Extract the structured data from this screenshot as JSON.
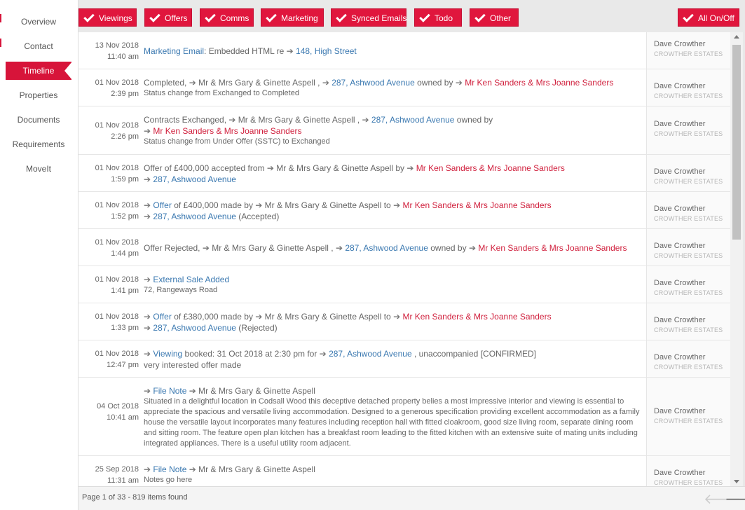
{
  "sidebar": {
    "items": [
      {
        "label": "Overview",
        "active": false
      },
      {
        "label": "Contact",
        "active": false
      },
      {
        "label": "Timeline",
        "active": true
      },
      {
        "label": "Properties",
        "active": false
      },
      {
        "label": "Documents",
        "active": false
      },
      {
        "label": "Requirements",
        "active": false
      },
      {
        "label": "MoveIt",
        "active": false
      }
    ]
  },
  "filters": {
    "buttons": [
      "Viewings",
      "Offers",
      "Comms",
      "Marketing",
      "Synced Emails",
      "Todo",
      "Other"
    ],
    "all_toggle": "All On/Off"
  },
  "colors": {
    "accent": "#d7143a",
    "link": "#3a78b0",
    "party": "#d01f3c"
  },
  "timeline": {
    "rows": [
      {
        "date": "13 Nov 2018",
        "time": "11:40 am",
        "parts": [
          [
            "l",
            "Marketing Email"
          ],
          [
            "t",
            ": Embedded HTML re "
          ],
          [
            "a",
            ""
          ],
          [
            "l",
            " 148, High Street"
          ]
        ],
        "sub": "",
        "agent": "Dave Crowther",
        "company": "CROWTHER ESTATES"
      },
      {
        "date": "01 Nov 2018",
        "time": "2:39 pm",
        "parts": [
          [
            "t",
            "Completed, "
          ],
          [
            "a",
            ""
          ],
          [
            "t",
            " Mr & Mrs Gary & Ginette Aspell , "
          ],
          [
            "a",
            ""
          ],
          [
            "l",
            " 287, Ashwood Avenue"
          ],
          [
            "t",
            " owned by "
          ],
          [
            "a",
            ""
          ],
          [
            "r",
            " Mr Ken Sanders & Mrs Joanne Sanders"
          ]
        ],
        "sub": "Status change from Exchanged to Completed",
        "agent": "Dave Crowther",
        "company": "CROWTHER ESTATES"
      },
      {
        "date": "01 Nov 2018",
        "time": "2:26 pm",
        "parts": [
          [
            "t",
            "Contracts Exchanged, "
          ],
          [
            "a",
            ""
          ],
          [
            "t",
            " Mr & Mrs Gary & Ginette Aspell , "
          ],
          [
            "a",
            ""
          ],
          [
            "l",
            " 287, Ashwood Avenue"
          ],
          [
            "t",
            " owned by"
          ],
          [
            "br",
            ""
          ],
          [
            "a",
            ""
          ],
          [
            "r",
            " Mr Ken Sanders & Mrs Joanne Sanders"
          ]
        ],
        "sub": "Status change from Under Offer (SSTC) to Exchanged",
        "agent": "Dave Crowther",
        "company": "CROWTHER ESTATES"
      },
      {
        "date": "01 Nov 2018",
        "time": "1:59 pm",
        "parts": [
          [
            "t",
            "Offer of £400,000 accepted from "
          ],
          [
            "a",
            ""
          ],
          [
            "t",
            " Mr & Mrs Gary & Ginette Aspell by "
          ],
          [
            "a",
            ""
          ],
          [
            "r",
            " Mr Ken Sanders & Mrs Joanne Sanders"
          ],
          [
            "br",
            ""
          ],
          [
            "a",
            ""
          ],
          [
            "l",
            " 287, Ashwood Avenue"
          ]
        ],
        "sub": "",
        "agent": "Dave Crowther",
        "company": "CROWTHER ESTATES"
      },
      {
        "date": "01 Nov 2018",
        "time": "1:52 pm",
        "parts": [
          [
            "a",
            ""
          ],
          [
            "l",
            " Offer"
          ],
          [
            "t",
            " of £400,000 made by "
          ],
          [
            "a",
            ""
          ],
          [
            "t",
            " Mr & Mrs Gary & Ginette Aspell to "
          ],
          [
            "a",
            ""
          ],
          [
            "r",
            " Mr Ken Sanders & Mrs Joanne Sanders"
          ],
          [
            "br",
            ""
          ],
          [
            "a",
            ""
          ],
          [
            "l",
            " 287, Ashwood Avenue"
          ],
          [
            "t",
            " (Accepted)"
          ]
        ],
        "sub": "",
        "agent": "Dave Crowther",
        "company": "CROWTHER ESTATES"
      },
      {
        "date": "01 Nov 2018",
        "time": "1:44 pm",
        "parts": [
          [
            "t",
            "Offer Rejected, "
          ],
          [
            "a",
            ""
          ],
          [
            "t",
            " Mr & Mrs Gary & Ginette Aspell , "
          ],
          [
            "a",
            ""
          ],
          [
            "l",
            " 287, Ashwood Avenue"
          ],
          [
            "t",
            " owned by "
          ],
          [
            "a",
            ""
          ],
          [
            "r",
            " Mr Ken Sanders & Mrs Joanne Sanders"
          ]
        ],
        "sub": "",
        "agent": "Dave Crowther",
        "company": "CROWTHER ESTATES"
      },
      {
        "date": "01 Nov 2018",
        "time": "1:41 pm",
        "parts": [
          [
            "a",
            ""
          ],
          [
            "l",
            " External Sale Added"
          ]
        ],
        "sub": "72, Rangeways Road",
        "agent": "Dave Crowther",
        "company": "CROWTHER ESTATES"
      },
      {
        "date": "01 Nov 2018",
        "time": "1:33 pm",
        "parts": [
          [
            "a",
            ""
          ],
          [
            "l",
            " Offer"
          ],
          [
            "t",
            " of £380,000 made by "
          ],
          [
            "a",
            ""
          ],
          [
            "t",
            " Mr & Mrs Gary & Ginette Aspell to "
          ],
          [
            "a",
            ""
          ],
          [
            "r",
            " Mr Ken Sanders & Mrs Joanne Sanders"
          ],
          [
            "br",
            ""
          ],
          [
            "a",
            ""
          ],
          [
            "l",
            " 287, Ashwood Avenue"
          ],
          [
            "t",
            " (Rejected)"
          ]
        ],
        "sub": "",
        "agent": "Dave Crowther",
        "company": "CROWTHER ESTATES"
      },
      {
        "date": "01 Nov 2018",
        "time": "12:47 pm",
        "parts": [
          [
            "a",
            ""
          ],
          [
            "l",
            " Viewing"
          ],
          [
            "t",
            " booked: 31 Oct 2018 at 2:30 pm for "
          ],
          [
            "a",
            ""
          ],
          [
            "l",
            " 287, Ashwood Avenue"
          ],
          [
            "t",
            " , unaccompanied [CONFIRMED]"
          ],
          [
            "br",
            ""
          ],
          [
            "t",
            "very interested offer made"
          ]
        ],
        "sub": "",
        "agent": "Dave Crowther",
        "company": "CROWTHER ESTATES"
      },
      {
        "date": "04 Oct 2018",
        "time": "10:41 am",
        "parts": [
          [
            "a",
            ""
          ],
          [
            "l",
            " File Note"
          ],
          [
            "t",
            " "
          ],
          [
            "a",
            ""
          ],
          [
            "t",
            " Mr & Mrs Gary & Ginette Aspell"
          ]
        ],
        "sub": "Situated in a delightful location in Codsall Wood this deceptive detached property belies a most impressive interior and viewing is essential to appreciate the spacious and versatile living accommodation. Designed to a generous specification providing excellent accommodation as a family house the versatile layout incorporates many features including reception hall with fitted cloakroom, good size living room, separate dining room and sitting room. The feature open plan kitchen has a breakfast room leading to the fitted kitchen with an extensive suite of mating units including integrated appliances. There is a useful utility room adjacent.",
        "agent": "Dave Crowther",
        "company": "CROWTHER ESTATES"
      },
      {
        "date": "25 Sep 2018",
        "time": "11:31 am",
        "parts": [
          [
            "a",
            ""
          ],
          [
            "l",
            " File Note"
          ],
          [
            "t",
            " "
          ],
          [
            "a",
            ""
          ],
          [
            "t",
            " Mr & Mrs Gary & Ginette Aspell"
          ]
        ],
        "sub": "Notes go here",
        "agent": "Dave Crowther",
        "company": "CROWTHER ESTATES"
      }
    ]
  },
  "footer": {
    "page_info": "Page 1 of 33 - 819 items found"
  }
}
